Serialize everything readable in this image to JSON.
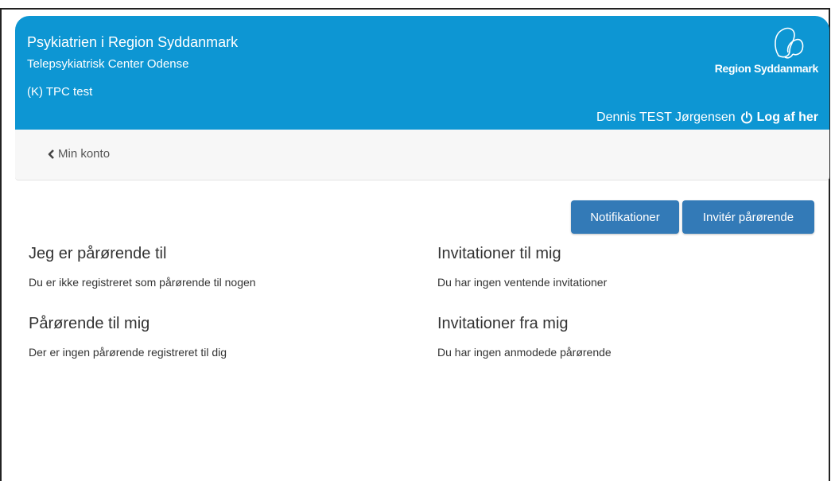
{
  "header": {
    "organization": "Psykiatrien i Region Syddanmark",
    "center": "Telepsykiatrisk Center Odense",
    "unit": "(K) TPC test",
    "logo_text": "Region Syddanmark",
    "user_name": "Dennis TEST Jørgensen",
    "logout_label": "Log af her",
    "color": "#0d96d3"
  },
  "subnav": {
    "back_label": "Min konto"
  },
  "actions": {
    "notifications_label": "Notifikationer",
    "invite_label": "Invitér pårørende",
    "button_color": "#337ab7"
  },
  "sections": {
    "relative_of": {
      "title": "Jeg er pårørende til",
      "text": "Du er ikke registreret som pårørende til nogen"
    },
    "invitations_to_me": {
      "title": "Invitationer til mig",
      "text": "Du har ingen ventende invitationer"
    },
    "relatives_of_me": {
      "title": "Pårørende til mig",
      "text": "Der er ingen pårørende registreret til dig"
    },
    "invitations_from_me": {
      "title": "Invitationer fra mig",
      "text": "Du har ingen anmodede pårørende"
    }
  }
}
